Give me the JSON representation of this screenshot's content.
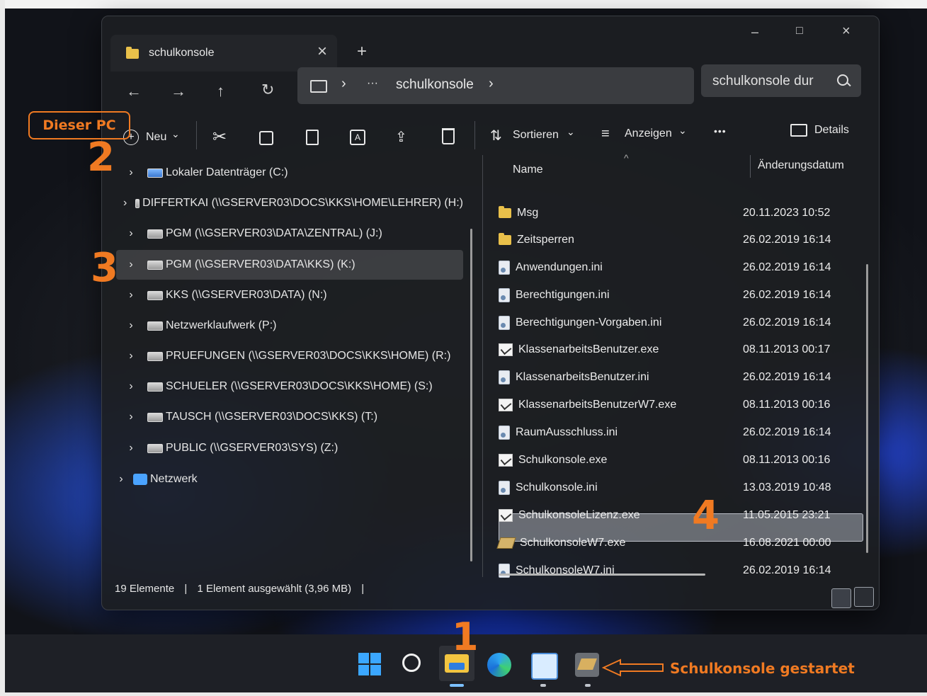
{
  "window": {
    "tab_title": "schulkonsole",
    "close_tab_glyph": "×",
    "new_tab_glyph": "+",
    "min_glyph": "–",
    "max_glyph": "□",
    "close_glyph": "×"
  },
  "navigation": {
    "back_glyph": "←",
    "forward_glyph": "→",
    "up_glyph": "↑",
    "refresh_glyph": "↻",
    "breadcrumb_sep": "›",
    "breadcrumb_more": "···",
    "breadcrumb_current": "schulkonsole",
    "breadcrumb_trailing": "›",
    "search_placeholder": "schulkonsole dur",
    "search_icon": "search-icon"
  },
  "toolbar": {
    "new_label": "Neu",
    "new_chevron": "⌄",
    "sort_label": "Sortieren",
    "sort_chevron": "⌄",
    "view_label": "Anzeigen",
    "view_chevron": "⌄",
    "more_glyph": "•••",
    "details_label": "Details"
  },
  "nav_pane": {
    "items": [
      {
        "label": "Lokaler Datenträger (C:)",
        "icon": "local-drive-icon"
      },
      {
        "label": "DIFFERTKAI (\\\\GSERVER03\\DOCS\\KKS\\HOME\\LEHRER) (H:)",
        "icon": "network-drive-icon"
      },
      {
        "label": "PGM (\\\\GSERVER03\\DATA\\ZENTRAL) (J:)",
        "icon": "network-drive-icon"
      },
      {
        "label": "PGM (\\\\GSERVER03\\DATA\\KKS) (K:)",
        "icon": "network-drive-icon"
      },
      {
        "label": "KKS (\\\\GSERVER03\\DATA) (N:)",
        "icon": "network-drive-icon"
      },
      {
        "label": "Netzwerklaufwerk (P:)",
        "icon": "network-drive-icon"
      },
      {
        "label": "PRUEFUNGEN (\\\\GSERVER03\\DOCS\\KKS\\HOME) (R:)",
        "icon": "network-drive-icon"
      },
      {
        "label": "SCHUELER (\\\\GSERVER03\\DOCS\\KKS\\HOME) (S:)",
        "icon": "network-drive-icon"
      },
      {
        "label": "TAUSCH (\\\\GSERVER03\\DOCS\\KKS) (T:)",
        "icon": "network-drive-icon"
      },
      {
        "label": "PUBLIC (\\\\GSERVER03\\SYS) (Z:)",
        "icon": "network-drive-icon"
      },
      {
        "label": "Netzwerk",
        "icon": "network-icon"
      }
    ],
    "chevron": "›"
  },
  "file_list": {
    "col_name": "Name",
    "col_date": "Änderungsdatum",
    "sort_indicator": "^",
    "files": [
      {
        "name": "Msg",
        "date": "20.11.2023 10:52",
        "type": "folder"
      },
      {
        "name": "Zeitsperren",
        "date": "26.02.2019 16:14",
        "type": "folder"
      },
      {
        "name": "Anwendungen.ini",
        "date": "26.02.2019 16:14",
        "type": "ini"
      },
      {
        "name": "Berechtigungen.ini",
        "date": "26.02.2019 16:14",
        "type": "ini"
      },
      {
        "name": "Berechtigungen-Vorgaben.ini",
        "date": "26.02.2019 16:14",
        "type": "ini"
      },
      {
        "name": "KlassenarbeitsBenutzer.exe",
        "date": "08.11.2013 00:17",
        "type": "exe"
      },
      {
        "name": "KlassenarbeitsBenutzer.ini",
        "date": "26.02.2019 16:14",
        "type": "ini"
      },
      {
        "name": "KlassenarbeitsBenutzerW7.exe",
        "date": "08.11.2013 00:16",
        "type": "exe"
      },
      {
        "name": "RaumAusschluss.ini",
        "date": "26.02.2019 16:14",
        "type": "ini"
      },
      {
        "name": "Schulkonsole.exe",
        "date": "08.11.2013 00:16",
        "type": "exe"
      },
      {
        "name": "Schulkonsole.ini",
        "date": "13.03.2019 10:48",
        "type": "ini"
      },
      {
        "name": "SchulkonsoleLizenz.exe",
        "date": "11.05.2015 23:21",
        "type": "exe"
      },
      {
        "name": "SchulkonsoleW7.exe",
        "date": "16.08.2021 00:00",
        "type": "exe-w7",
        "selected": true
      },
      {
        "name": "SchulkonsoleW7.ini",
        "date": "26.02.2019 16:14",
        "type": "ini"
      }
    ]
  },
  "status": {
    "count": "19 Elemente",
    "separator": "|",
    "selection": "1 Element ausgewählt (3,96 MB)",
    "separator2": "|"
  },
  "taskbar": {
    "icons": [
      "windows-start-icon",
      "search-icon",
      "file-explorer-icon",
      "edge-icon",
      "remote-app-icon",
      "schulkonsole-icon"
    ]
  },
  "annotations": {
    "dieser_pc": "Dieser PC",
    "step1": "1",
    "step2": "2",
    "step3": "3",
    "step4": "4",
    "arrow_caption": "Schulkonsole gestartet"
  },
  "colors": {
    "annotation": "#f07a22",
    "selection": "#c8cdd4",
    "folder": "#e9c04a"
  }
}
